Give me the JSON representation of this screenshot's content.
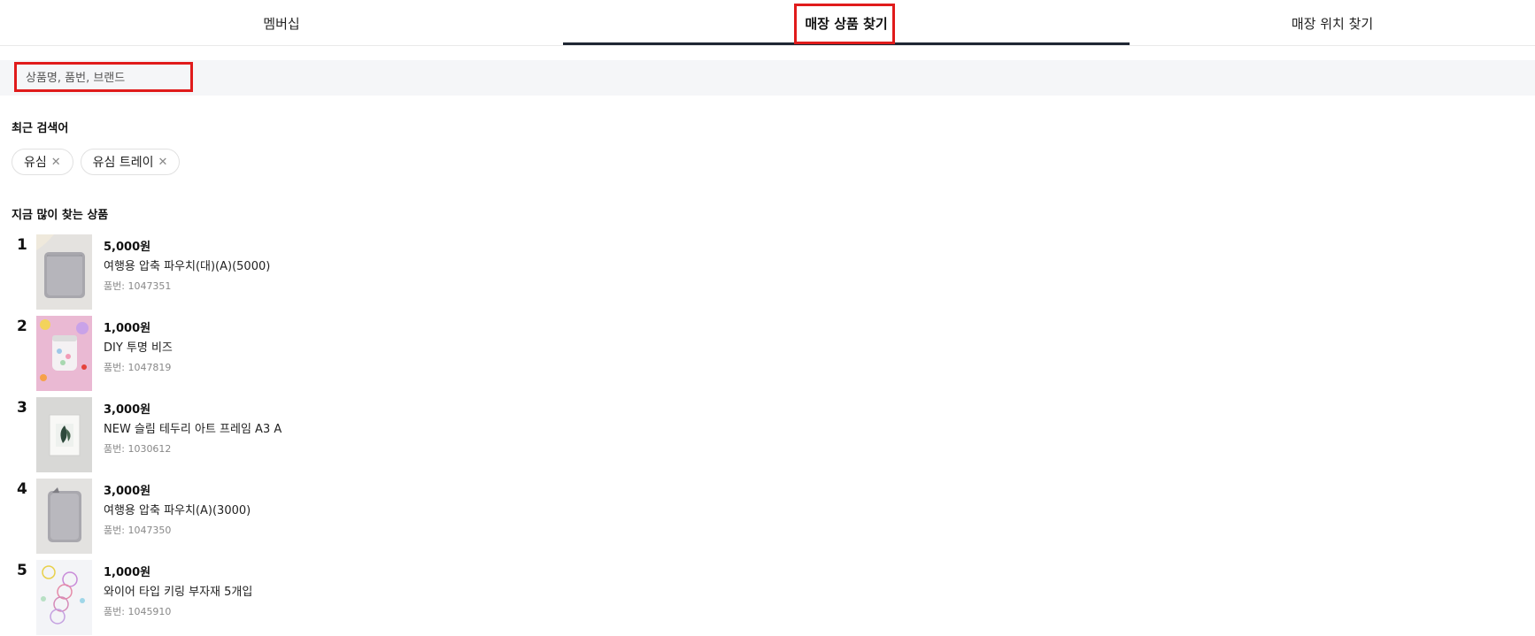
{
  "tabs": {
    "members": "멤버십",
    "product_search": "매장 상품 찾기",
    "store_location": "매장 위치 찾기"
  },
  "search": {
    "placeholder": "상품명, 품번, 브랜드"
  },
  "recent": {
    "title": "최근 검색어",
    "chips": [
      {
        "label": "유심",
        "close": "✕"
      },
      {
        "label": "유심 트레이",
        "close": "✕"
      }
    ]
  },
  "popular": {
    "title": "지금 많이 찾는 상품",
    "items": [
      {
        "rank": "1",
        "price": "5,000원",
        "name": "여행용 압축 파우치(대)(A)(5000)",
        "code": "품번: 1047351",
        "thumb_icon": "gray-pouch-image"
      },
      {
        "rank": "2",
        "price": "1,000원",
        "name": "DIY 투명 비즈",
        "code": "품번: 1047819",
        "thumb_icon": "bead-jar-image"
      },
      {
        "rank": "3",
        "price": "3,000원",
        "name": "NEW 슬림 테두리 아트 프레임 A3 A",
        "code": "품번: 1030612",
        "thumb_icon": "art-frame-image"
      },
      {
        "rank": "4",
        "price": "3,000원",
        "name": "여행용 압축 파우치(A)(3000)",
        "code": "품번: 1047350",
        "thumb_icon": "gray-pouch-image"
      },
      {
        "rank": "5",
        "price": "1,000원",
        "name": "와이어 타입 키링 부자재 5개입",
        "code": "품번: 1045910",
        "thumb_icon": "keyring-image"
      }
    ]
  },
  "colors": {
    "active_tab_bar": "#1f2633",
    "highlight": "#e01b1b",
    "search_bg": "#f5f6f8"
  }
}
